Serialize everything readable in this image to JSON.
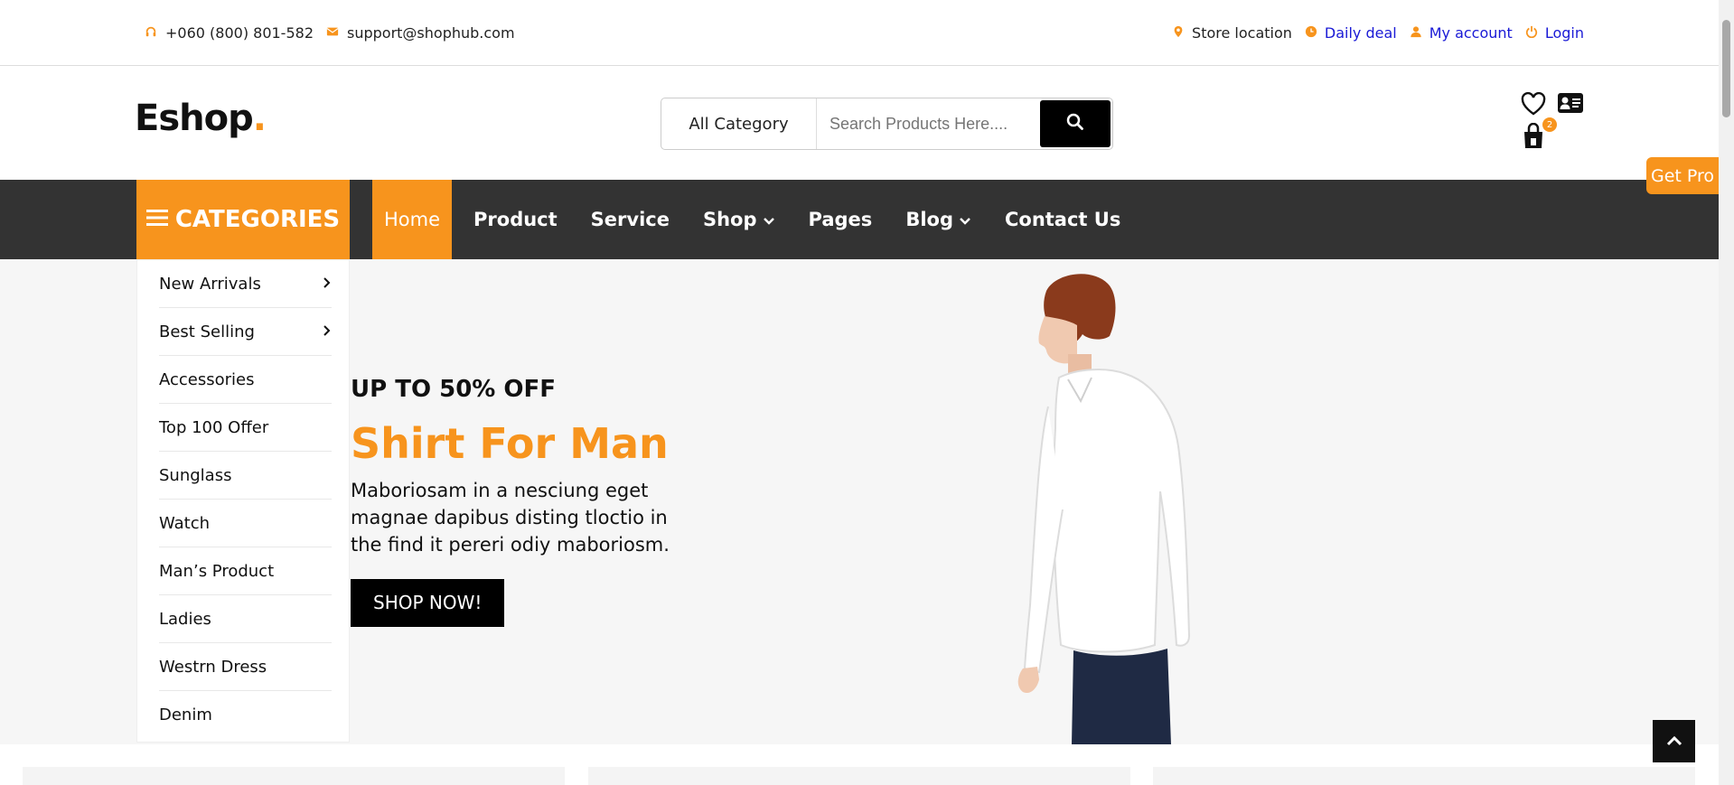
{
  "topbar": {
    "phone": "+060 (800) 801-582",
    "email": "support@shophub.com",
    "store_location": "Store location",
    "daily_deal": "Daily deal",
    "my_account": "My account",
    "login": "Login"
  },
  "header": {
    "logo": "Eshop",
    "logo_dot": ".",
    "search_category": "All Category",
    "search_placeholder": "Search Products Here....",
    "cart_count": "2"
  },
  "nav": {
    "categories_label": "CATEGORIES",
    "items": [
      {
        "label": "Home"
      },
      {
        "label": "Product"
      },
      {
        "label": "Service"
      },
      {
        "label": "Shop"
      },
      {
        "label": "Pages"
      },
      {
        "label": "Blog"
      },
      {
        "label": "Contact Us"
      }
    ]
  },
  "sidebar": {
    "items": [
      {
        "label": "New Arrivals"
      },
      {
        "label": "Best Selling"
      },
      {
        "label": "Accessories"
      },
      {
        "label": "Top 100 Offer"
      },
      {
        "label": "Sunglass"
      },
      {
        "label": "Watch"
      },
      {
        "label": "Man’s Product"
      },
      {
        "label": "Ladies"
      },
      {
        "label": "Westrn Dress"
      },
      {
        "label": "Denim"
      }
    ]
  },
  "hero": {
    "subtitle": "UP TO 50% OFF",
    "title": "Shirt For Man",
    "description": "Maboriosam in a nesciung eget magnae dapibus disting tloctio in the find it pereri odiy maboriosm.",
    "button": "SHOP NOW!"
  },
  "get_pro": "Get Pro",
  "colors": {
    "accent": "#f7941d",
    "nav_bg": "#333333",
    "link": "#1a1ad6"
  }
}
